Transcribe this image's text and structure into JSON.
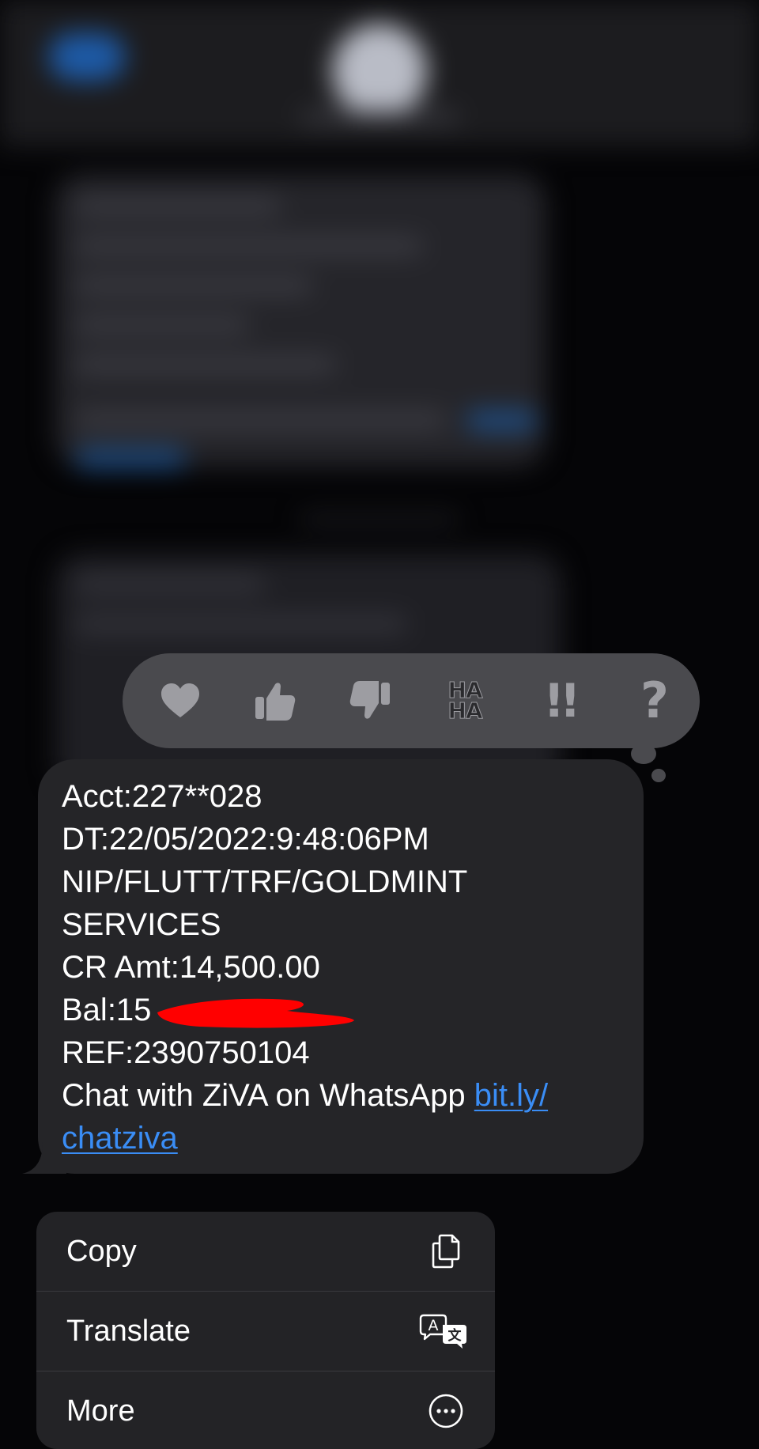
{
  "reactions": [
    {
      "name": "heart-icon"
    },
    {
      "name": "thumbs-up-icon"
    },
    {
      "name": "thumbs-down-icon"
    },
    {
      "name": "haha-icon",
      "line1": "HA",
      "line2": "HA"
    },
    {
      "name": "exclamation-icon",
      "glyph": "!!"
    },
    {
      "name": "question-icon",
      "glyph": "?"
    }
  ],
  "message": {
    "acct": "Acct:227**028",
    "dt": "DT:22/05/2022:9:48:06PM",
    "narration_1": "NIP/FLUTT/TRF/GOLDMINT",
    "narration_2": "SERVICES",
    "cr_amt": "CR Amt:14,500.00",
    "bal": "Bal:15",
    "ref": "REF:2390750104",
    "promo_text": "Chat with ZiVA on WhatsApp ",
    "link_part1": "bit.ly/",
    "link_part2": "chatziva"
  },
  "menu": {
    "items": [
      {
        "label": "Copy",
        "icon": "copy-icon"
      },
      {
        "label": "Translate",
        "icon": "translate-icon"
      },
      {
        "label": "More",
        "icon": "more-icon"
      }
    ]
  },
  "colors": {
    "background": "#050507",
    "bubble": "#252528",
    "tapback": "#4a4a4e",
    "link": "#3a8df5",
    "redaction": "#ff0000"
  }
}
